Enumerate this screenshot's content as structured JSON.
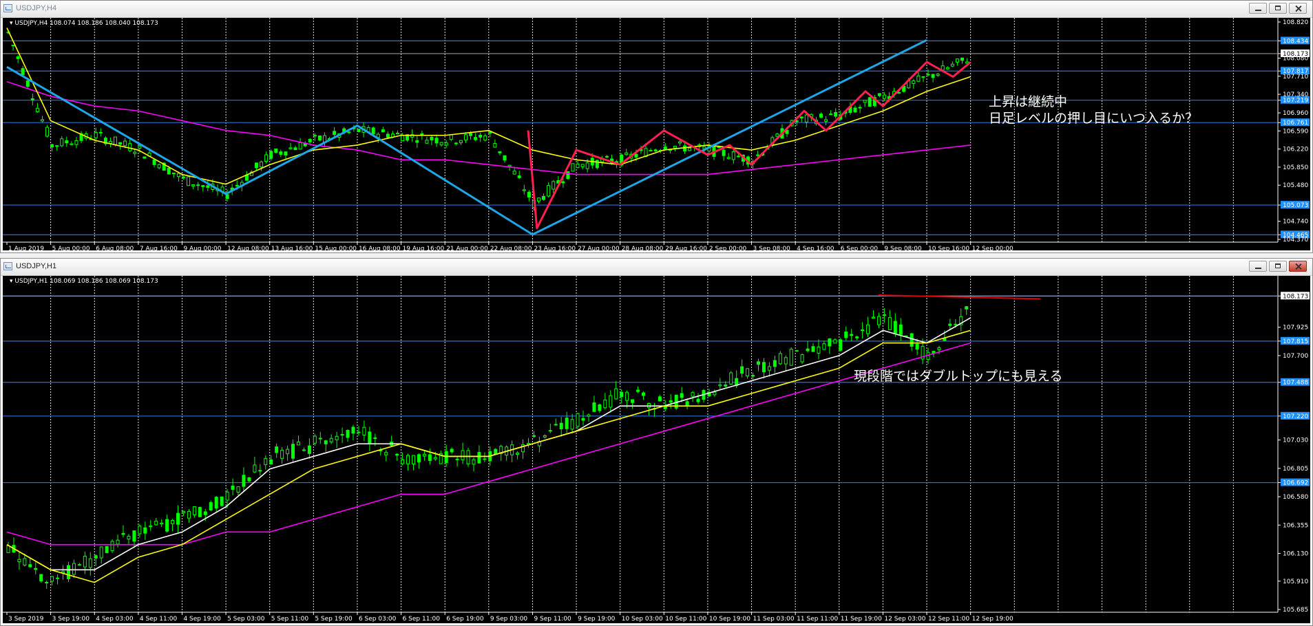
{
  "windows": [
    {
      "title": "USDJPY,H4",
      "header": "USDJPY,H4  108.074 108.186 108.040 108.173",
      "price_scale": [
        "108.820",
        "108.434",
        "108.173",
        "108.080",
        "107.817",
        "107.710",
        "107.340",
        "107.219",
        "106.960",
        "106.761",
        "106.590",
        "106.220",
        "105.850",
        "105.480",
        "105.073",
        "104.740",
        "104.465",
        "104.370"
      ],
      "time_labels": [
        "1 Aug 2019",
        "5 Aug 00:00",
        "6 Aug 08:00",
        "7 Aug 16:00",
        "9 Aug 00:00",
        "12 Aug 08:00",
        "13 Aug 16:00",
        "15 Aug 00:00",
        "16 Aug 08:00",
        "19 Aug 16:00",
        "21 Aug 00:00",
        "22 Aug 08:00",
        "23 Aug 16:00",
        "27 Aug 00:00",
        "28 Aug 08:00",
        "29 Aug 16:00",
        "2 Sep 00:00",
        "3 Sep 08:00",
        "4 Sep 16:00",
        "6 Sep 00:00",
        "9 Sep 08:00",
        "10 Sep 16:00",
        "12 Sep 00:00"
      ],
      "annotation": [
        "上昇は継続中",
        "日足レベルの押し目にいつ入るか？"
      ]
    },
    {
      "title": "USDJPY,H1",
      "header": "USDJPY,H1  108.069 108.186 108.069 108.173",
      "price_scale": [
        "108.173",
        "107.925",
        "107.815",
        "107.700",
        "107.488",
        "107.220",
        "107.030",
        "106.805",
        "106.692",
        "106.580",
        "106.355",
        "106.130",
        "105.910",
        "105.685"
      ],
      "time_labels": [
        "3 Sep 2019",
        "3 Sep 19:00",
        "4 Sep 03:00",
        "4 Sep 11:00",
        "4 Sep 19:00",
        "5 Sep 03:00",
        "5 Sep 11:00",
        "5 Sep 19:00",
        "6 Sep 03:00",
        "6 Sep 11:00",
        "6 Sep 19:00",
        "9 Sep 03:00",
        "9 Sep 11:00",
        "9 Sep 19:00",
        "10 Sep 03:00",
        "10 Sep 11:00",
        "10 Sep 19:00",
        "11 Sep 03:00",
        "11 Sep 11:00",
        "11 Sep 19:00",
        "12 Sep 03:00",
        "12 Sep 11:00",
        "12 Sep 19:00"
      ],
      "annotation": [
        "現段階ではダブルトップにも見える"
      ]
    }
  ],
  "colors": {
    "candle": "#00ff00",
    "grid": "#ffffff",
    "hline": "#2f6fd6",
    "price_box": "#1e90ff",
    "ma_fast": "#ffff00",
    "ma_slow": "#ff00ff",
    "ma_white": "#ffffff",
    "hand_red": "#ff2050",
    "hand_blue": "#1ea7e8",
    "resistance": "#e00000"
  },
  "chart_data": [
    {
      "type": "candlestick",
      "symbol": "USDJPY",
      "timeframe": "H4",
      "ylim": [
        104.37,
        108.82
      ],
      "horizontal_levels": [
        108.434,
        107.817,
        107.219,
        106.761,
        105.073,
        104.465
      ],
      "last_price": 108.173,
      "x": [
        "1 Aug 2019",
        "5 Aug 00:00",
        "6 Aug 08:00",
        "7 Aug 16:00",
        "9 Aug 00:00",
        "12 Aug 08:00",
        "13 Aug 16:00",
        "15 Aug 00:00",
        "16 Aug 08:00",
        "19 Aug 16:00",
        "21 Aug 00:00",
        "22 Aug 08:00",
        "23 Aug 16:00",
        "27 Aug 00:00",
        "28 Aug 08:00",
        "29 Aug 16:00",
        "2 Sep 00:00",
        "3 Sep 08:00",
        "4 Sep 16:00",
        "6 Sep 00:00",
        "9 Sep 08:00",
        "10 Sep 16:00",
        "12 Sep 00:00"
      ],
      "close": [
        108.6,
        106.3,
        106.5,
        106.2,
        105.6,
        105.3,
        106.1,
        106.4,
        106.6,
        106.5,
        106.4,
        106.5,
        105.1,
        105.9,
        106.0,
        106.3,
        106.2,
        106.0,
        106.8,
        106.9,
        107.3,
        107.7,
        108.1
      ],
      "ma_fast": [
        108.7,
        106.8,
        106.4,
        106.2,
        105.7,
        105.5,
        105.9,
        106.2,
        106.3,
        106.5,
        106.5,
        106.6,
        106.2,
        106.0,
        105.9,
        106.2,
        106.3,
        106.2,
        106.4,
        106.7,
        107.0,
        107.4,
        107.7
      ],
      "ma_slow": [
        107.6,
        107.3,
        107.1,
        107.0,
        106.8,
        106.6,
        106.5,
        106.3,
        106.2,
        106.0,
        106.0,
        105.9,
        105.8,
        105.7,
        105.7,
        105.7,
        105.7,
        105.8,
        105.9,
        106.0,
        106.1,
        106.2,
        106.3
      ]
    },
    {
      "type": "candlestick",
      "symbol": "USDJPY",
      "timeframe": "H1",
      "ylim": [
        105.685,
        108.3
      ],
      "horizontal_levels": [
        108.173,
        107.815,
        107.488,
        107.22,
        106.692
      ],
      "last_price": 108.173,
      "x": [
        "3 Sep 2019",
        "3 Sep 19:00",
        "4 Sep 03:00",
        "4 Sep 11:00",
        "4 Sep 19:00",
        "5 Sep 03:00",
        "5 Sep 11:00",
        "5 Sep 19:00",
        "6 Sep 03:00",
        "6 Sep 11:00",
        "6 Sep 19:00",
        "9 Sep 03:00",
        "9 Sep 11:00",
        "9 Sep 19:00",
        "10 Sep 03:00",
        "10 Sep 11:00",
        "10 Sep 19:00",
        "11 Sep 03:00",
        "11 Sep 11:00",
        "11 Sep 19:00",
        "12 Sep 03:00",
        "12 Sep 11:00",
        "12 Sep 19:00"
      ],
      "close": [
        106.2,
        105.9,
        106.1,
        106.3,
        106.4,
        106.6,
        106.9,
        107.0,
        107.1,
        106.9,
        106.9,
        106.9,
        107.0,
        107.2,
        107.4,
        107.3,
        107.4,
        107.6,
        107.7,
        107.8,
        108.0,
        107.7,
        108.1
      ],
      "ma_white": [
        106.2,
        106.0,
        106.0,
        106.2,
        106.3,
        106.5,
        106.8,
        106.9,
        107.0,
        107.0,
        106.9,
        106.9,
        107.0,
        107.1,
        107.3,
        107.3,
        107.4,
        107.5,
        107.6,
        107.7,
        107.9,
        107.8,
        108.0
      ],
      "ma_fast": [
        106.2,
        106.0,
        105.9,
        106.1,
        106.2,
        106.4,
        106.6,
        106.8,
        106.9,
        107.0,
        106.9,
        106.9,
        107.0,
        107.1,
        107.2,
        107.3,
        107.3,
        107.4,
        107.5,
        107.6,
        107.8,
        107.8,
        107.9
      ],
      "ma_slow": [
        106.3,
        106.2,
        106.2,
        106.2,
        106.2,
        106.3,
        106.3,
        106.4,
        106.5,
        106.6,
        106.6,
        106.7,
        106.8,
        106.9,
        107.0,
        107.1,
        107.2,
        107.3,
        107.4,
        107.5,
        107.6,
        107.7,
        107.8
      ]
    }
  ]
}
